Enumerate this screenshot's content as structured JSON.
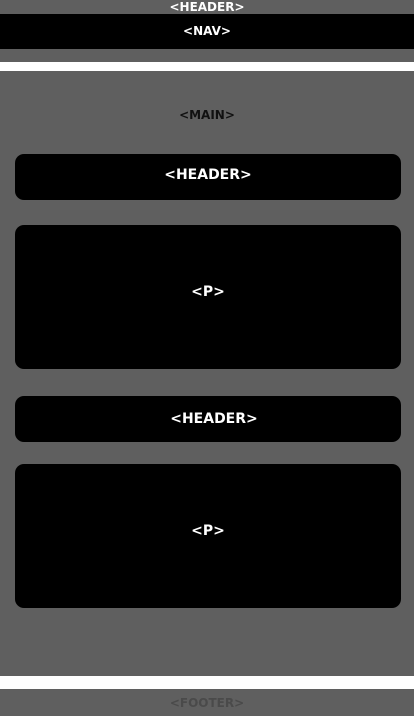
{
  "page_header": {
    "label": "<HEADER>"
  },
  "nav": {
    "label": "<NAV>"
  },
  "main": {
    "label": "<MAIN>",
    "blocks": [
      {
        "label": "<HEADER>"
      },
      {
        "label": "<P>"
      },
      {
        "label": "<HEADER>"
      },
      {
        "label": "<P>"
      }
    ]
  },
  "footer": {
    "label": "<FOOTER>"
  },
  "colors": {
    "page_background": "#5f5f5f",
    "block": "#000000",
    "strip": "#ffffff",
    "label_light": "#ffffff"
  }
}
